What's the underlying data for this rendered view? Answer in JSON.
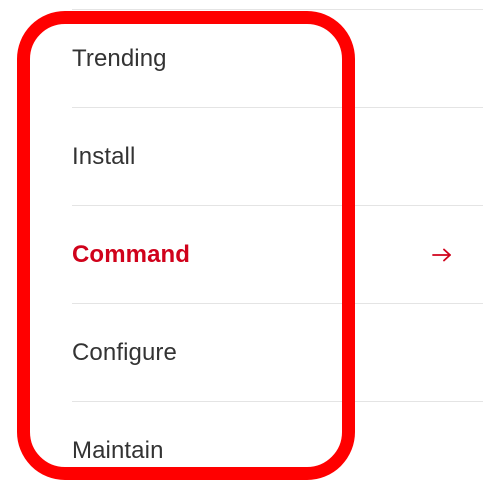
{
  "menu": {
    "items": [
      {
        "label": "Trending",
        "active": false
      },
      {
        "label": "Install",
        "active": false
      },
      {
        "label": "Command",
        "active": true
      },
      {
        "label": "Configure",
        "active": false
      },
      {
        "label": "Maintain",
        "active": false
      }
    ],
    "active_arrow_icon": "arrow-right-icon"
  },
  "colors": {
    "active_text": "#d0021b",
    "text": "#333333",
    "divider": "#e4e4e4",
    "highlight_frame": "#ff0000"
  }
}
